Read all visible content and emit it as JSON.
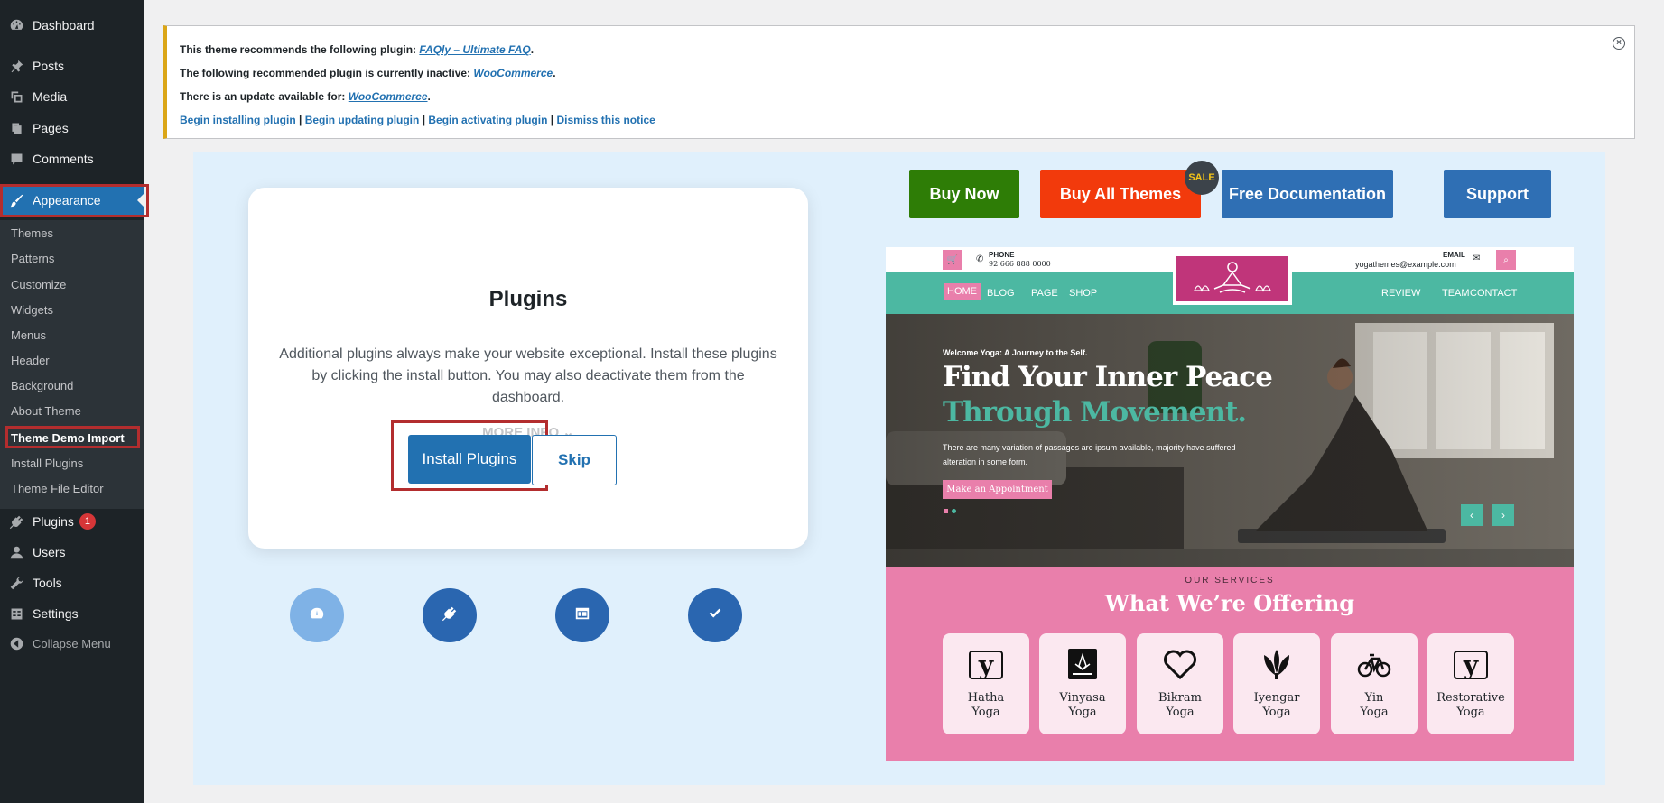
{
  "sidebar": {
    "dashboard": "Dashboard",
    "posts": "Posts",
    "media": "Media",
    "pages": "Pages",
    "comments": "Comments",
    "appearance": "Appearance",
    "submenu": [
      "Themes",
      "Patterns",
      "Customize",
      "Widgets",
      "Menus",
      "Header",
      "Background",
      "About Theme",
      "Theme Demo Import",
      "Install Plugins",
      "Theme File Editor"
    ],
    "plugins": "Plugins",
    "plugins_badge": "1",
    "users": "Users",
    "tools": "Tools",
    "settings": "Settings",
    "collapse": "Collapse Menu"
  },
  "notice": {
    "line1_text": "This theme recommends the following plugin:",
    "line1_link": "FAQly – Ultimate FAQ",
    "line2_text": "The following recommended plugin is currently inactive:",
    "line2_link": "WooCommerce",
    "line3_text": "There is an update available for:",
    "line3_link": "WooCommerce",
    "actions": [
      "Begin installing plugin",
      "Begin updating plugin",
      "Begin activating plugin",
      "Dismiss this notice"
    ]
  },
  "card": {
    "title": "Plugins",
    "description": "Additional plugins always make your website exceptional. Install these plugins by clicking the install button. You may also deactivate them from the dashboard.",
    "more_info": "MORE INFO",
    "install_label": "Install Plugins",
    "skip_label": "Skip"
  },
  "top_buttons": {
    "buy_now": "Buy Now",
    "buy_all": "Buy All Themes",
    "sale": "SALE",
    "docs": "Free Documentation",
    "support": "Support"
  },
  "colors": {
    "buy_now": "#2e7d06",
    "buy_all": "#f23a0c",
    "docs": "#2f6fb4",
    "support": "#2f6fb4"
  },
  "preview": {
    "phone_label": "PHONE",
    "phone": "92 666 888 0000",
    "email_label": "EMAIL",
    "email": "yogathemes@example.com",
    "nav": [
      "HOME",
      "BLOG",
      "PAGE",
      "SHOP",
      "REVIEW",
      "TEAM",
      "CONTACT"
    ],
    "hero_kicker": "Welcome Yoga: A Journey to the Self.",
    "hero_title1": "Find Your Inner Peace",
    "hero_title2": "Through Movement.",
    "hero_desc": "There are many variation of passages are ipsum available, majority have suffered alteration in some form.",
    "hero_button": "Make an Appointment",
    "services_kicker": "OUR SERVICES",
    "services_title": "What We’re Offering",
    "services": [
      {
        "line1": "Hatha",
        "line2": "Yoga"
      },
      {
        "line1": "Vinyasa",
        "line2": "Yoga"
      },
      {
        "line1": "Bikram",
        "line2": "Yoga"
      },
      {
        "line1": "Iyengar",
        "line2": "Yoga"
      },
      {
        "line1": "Yin",
        "line2": "Yoga"
      },
      {
        "line1": "Restorative",
        "line2": "Yoga"
      }
    ]
  }
}
